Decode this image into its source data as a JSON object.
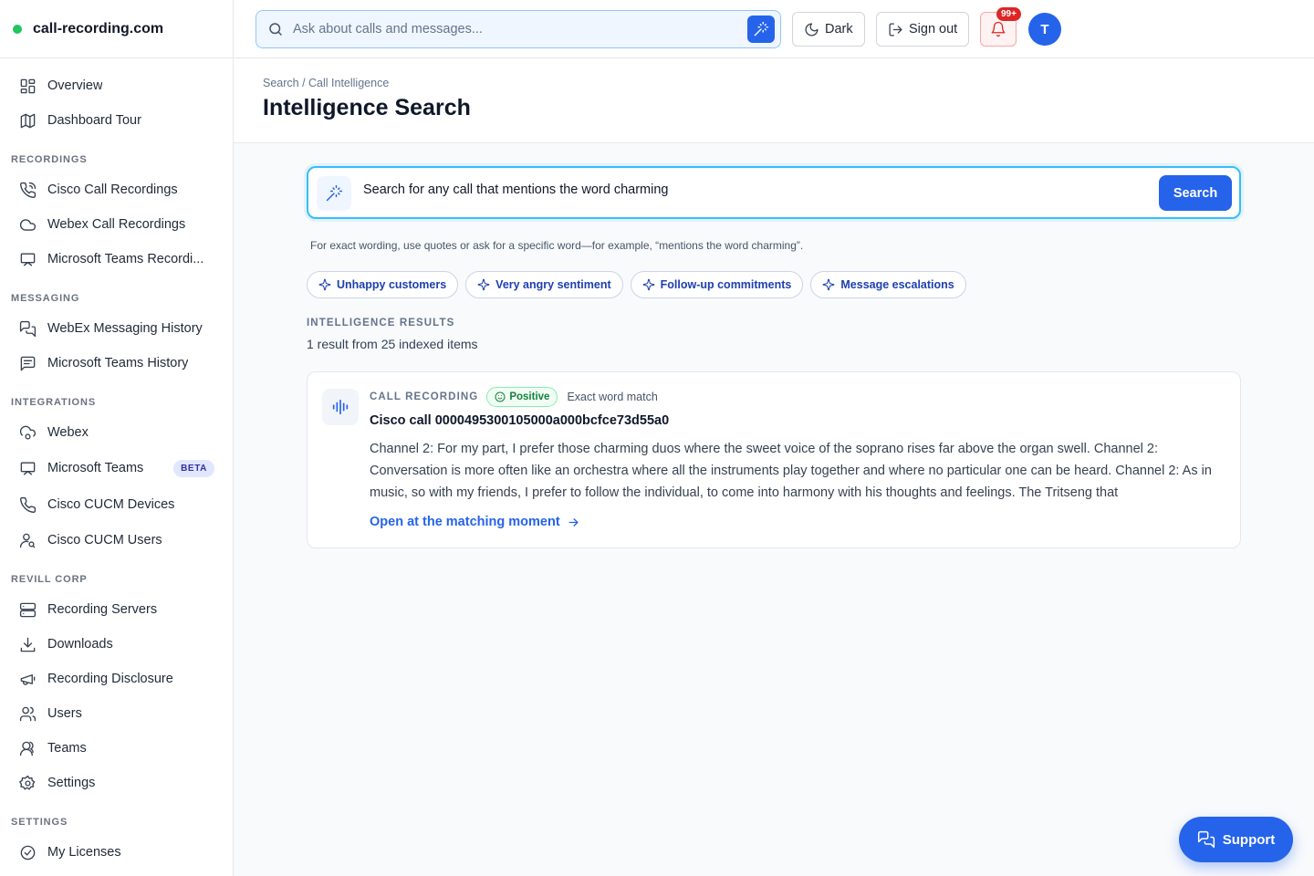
{
  "brand": {
    "name": "call-recording.com",
    "status_color": "#22c55e"
  },
  "sidebar": {
    "top_items": [
      {
        "label": "Overview",
        "icon": "grid-icon"
      },
      {
        "label": "Dashboard Tour",
        "icon": "map-icon"
      }
    ],
    "sections": [
      {
        "title": "RECORDINGS",
        "items": [
          {
            "label": "Cisco Call Recordings",
            "icon": "phone-call-icon"
          },
          {
            "label": "Webex Call Recordings",
            "icon": "cloud-icon"
          },
          {
            "label": "Microsoft Teams Recordi...",
            "icon": "monitor-icon"
          }
        ]
      },
      {
        "title": "MESSAGING",
        "items": [
          {
            "label": "WebEx Messaging History",
            "icon": "messages-icon"
          },
          {
            "label": "Microsoft Teams History",
            "icon": "message-square-text-icon"
          }
        ]
      },
      {
        "title": "INTEGRATIONS",
        "items": [
          {
            "label": "Webex",
            "icon": "cloud-cog-icon"
          },
          {
            "label": "Microsoft Teams",
            "icon": "monitor-icon",
            "badge": "BETA"
          },
          {
            "label": "Cisco CUCM Devices",
            "icon": "phone-icon"
          },
          {
            "label": "Cisco CUCM Users",
            "icon": "user-search-icon"
          }
        ]
      },
      {
        "title": "REVILL CORP",
        "items": [
          {
            "label": "Recording Servers",
            "icon": "server-icon"
          },
          {
            "label": "Downloads",
            "icon": "download-icon"
          },
          {
            "label": "Recording Disclosure",
            "icon": "megaphone-icon"
          },
          {
            "label": "Users",
            "icon": "users-icon"
          },
          {
            "label": "Teams",
            "icon": "user-group-icon"
          },
          {
            "label": "Settings",
            "icon": "gear-icon"
          }
        ]
      },
      {
        "title": "SETTINGS",
        "items": [
          {
            "label": "My Licenses",
            "icon": "check-circle-icon"
          }
        ]
      }
    ]
  },
  "topbar": {
    "search_placeholder": "Ask about calls and messages...",
    "dark_label": "Dark",
    "signout_label": "Sign out",
    "notification_badge": "99+",
    "avatar_initial": "T"
  },
  "page": {
    "breadcrumb": "Search / Call Intelligence",
    "title": "Intelligence Search"
  },
  "search": {
    "query": "Search for any call that mentions the word charming",
    "button_label": "Search",
    "hint": "For exact wording, use quotes or ask for a specific word—for example, “mentions the word charming”.",
    "suggestions": [
      "Unhappy customers",
      "Very angry sentiment",
      "Follow-up commitments",
      "Message escalations"
    ]
  },
  "results": {
    "title": "INTELLIGENCE RESULTS",
    "count_text": "1 result from 25 indexed items",
    "items": [
      {
        "type": "CALL RECORDING",
        "sentiment": "Positive",
        "match_type": "Exact word match",
        "title": "Cisco call 0000495300105000a000bcfce73d55a0",
        "snippet": "Channel 2: For my part, I prefer those charming duos where the sweet voice of the soprano rises far above the organ swell. Channel 2: Conversation is more often like an orchestra where all the instruments play together and where no particular one can be heard. Channel 2: As in music, so with my friends, I prefer to follow the individual, to come into harmony with his thoughts and feelings. The Tritseng that",
        "link_label": "Open at the matching moment"
      }
    ]
  },
  "support": {
    "label": "Support"
  },
  "colors": {
    "accent": "#2563eb",
    "danger": "#dc2626",
    "success": "#15803d"
  }
}
